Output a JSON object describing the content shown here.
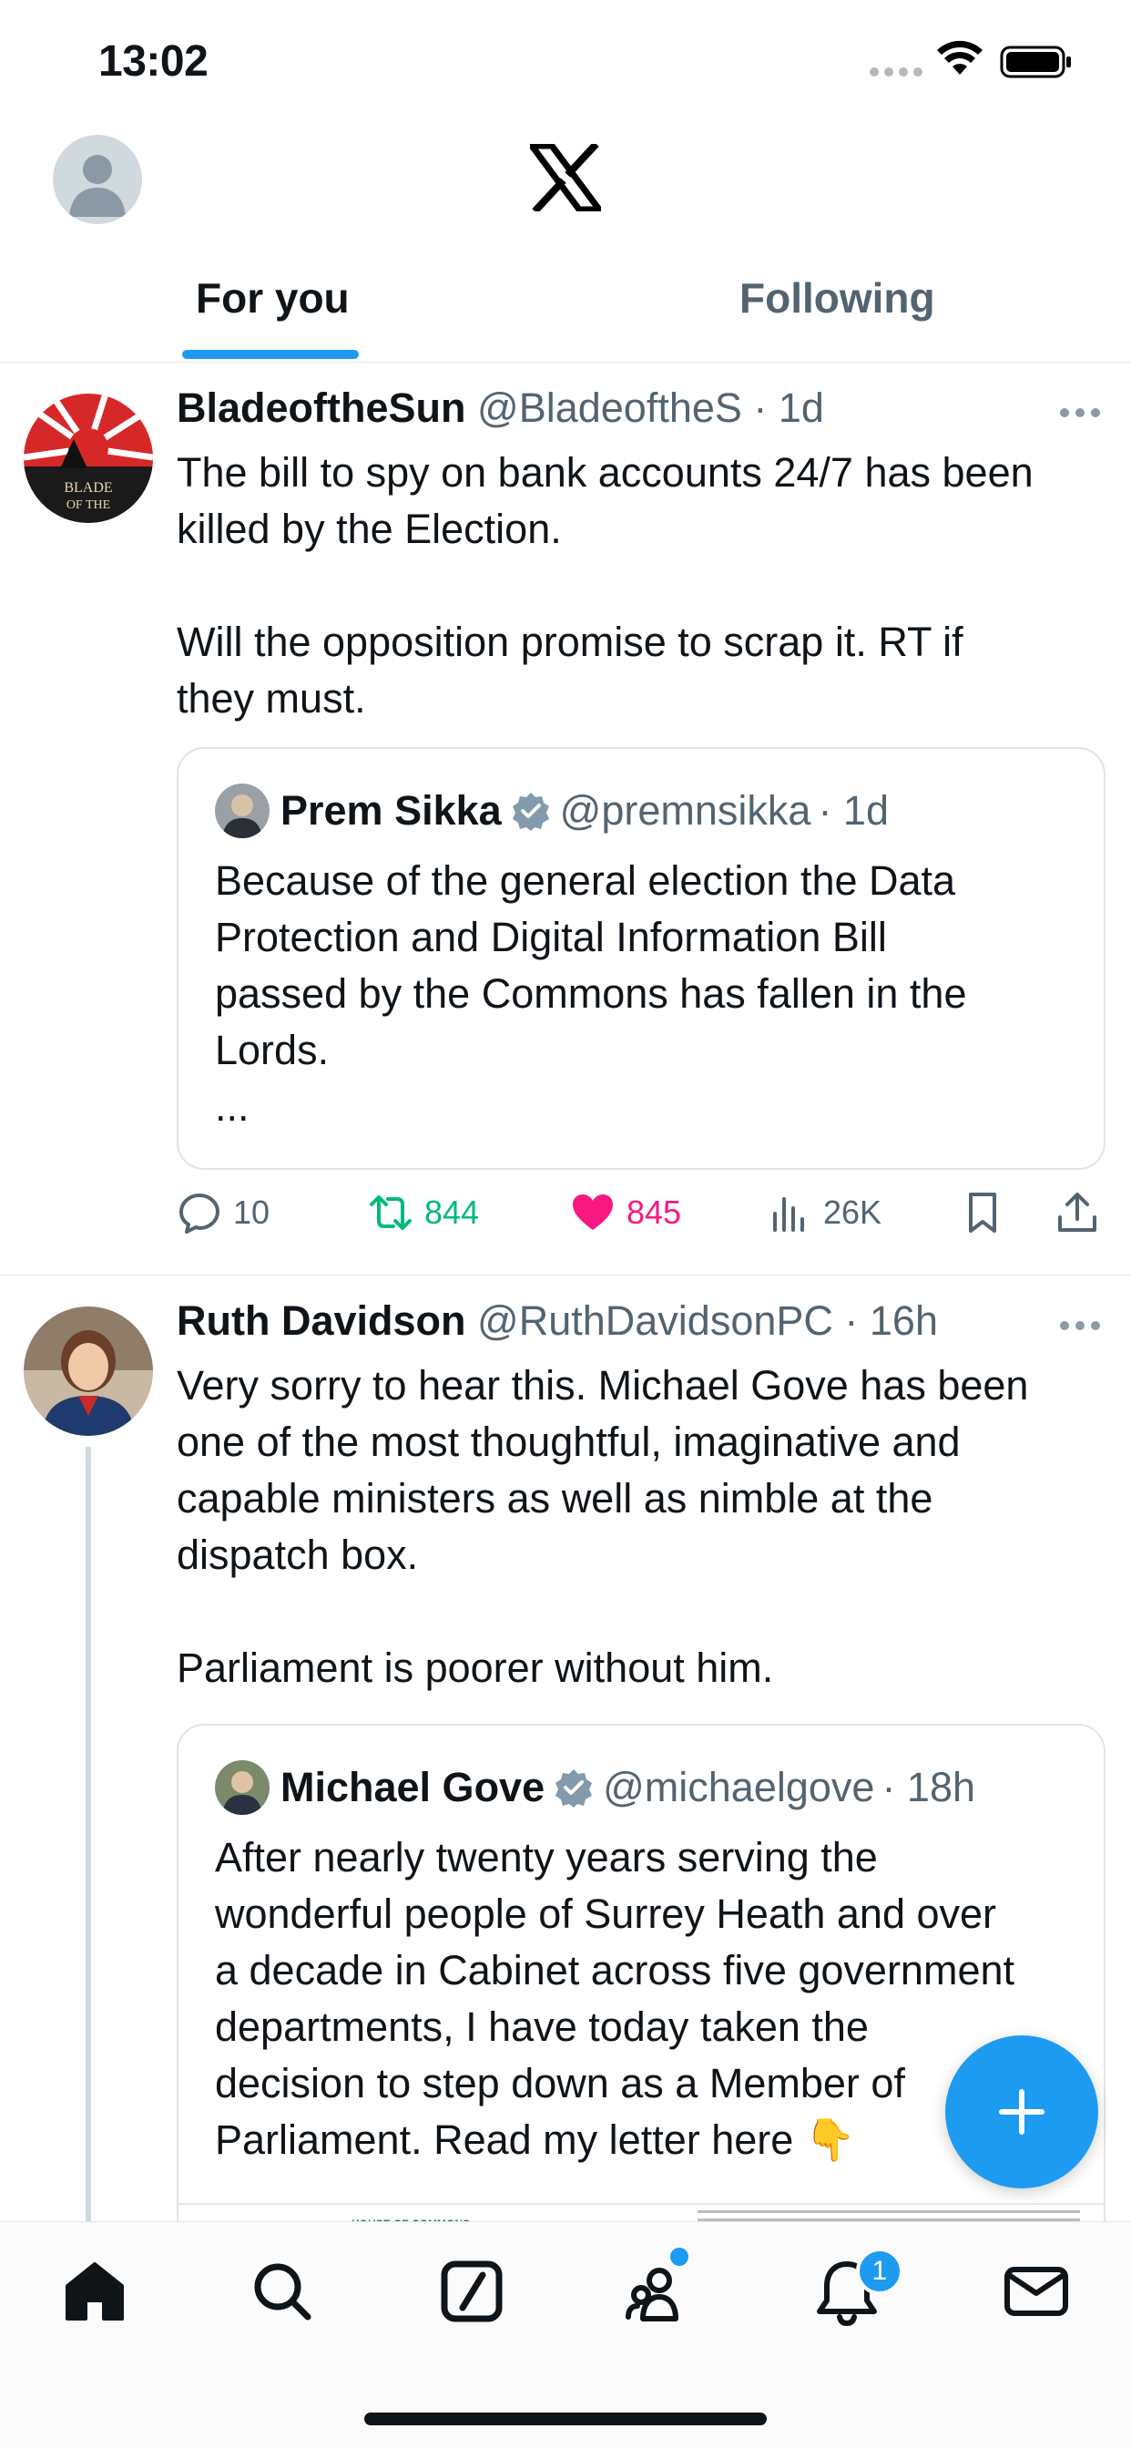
{
  "status_bar": {
    "time": "13:02"
  },
  "tabs": {
    "for_you": "For you",
    "following": "Following"
  },
  "posts": [
    {
      "name": "BladeoftheSun",
      "handle": "@BladeoftheS",
      "time": "· 1d",
      "text_lines": [
        "The bill to spy on bank accounts 24/7 has been",
        "killed by the Election.",
        "",
        "Will the opposition promise to scrap it. RT if",
        "they must."
      ],
      "quote": {
        "name": "Prem Sikka",
        "handle": "@premnsikka",
        "time": "· 1d",
        "text_lines": [
          "Because of the general election the Data",
          "Protection and Digital Information Bill",
          "passed by the Commons has fallen in the",
          "Lords.",
          "..."
        ]
      },
      "stats": {
        "replies": "10",
        "retweets": "844",
        "likes": "845",
        "views": "26K"
      }
    },
    {
      "name": "Ruth Davidson",
      "handle": "@RuthDavidsonPC",
      "time": "· 16h",
      "text_lines": [
        "Very sorry to hear this. Michael Gove has been",
        "one of the most thoughtful, imaginative and",
        "capable ministers as well as nimble at the",
        "dispatch box.",
        "",
        "Parliament is poorer without him."
      ],
      "quote": {
        "name": "Michael Gove",
        "handle": "@michaelgove",
        "time": "· 18h",
        "text_lines": [
          "After nearly twenty years serving the",
          "wonderful people of Surrey Heath and over",
          "a decade in Cabinet across five government",
          "departments, I have today taken the",
          "decision to step down as a Member of",
          "Parliament.  Read my letter here 👇"
        ],
        "attachment_label": "HOUSE OF COMMONS"
      }
    }
  ],
  "bottom_nav": {
    "notifications_badge": "1"
  },
  "colors": {
    "accent": "#1d9bf0",
    "retweet": "#00ba7c",
    "like": "#f91880",
    "muted": "#536471"
  },
  "icons": [
    "x-logo-icon",
    "reply-icon",
    "retweet-icon",
    "heart-icon",
    "views-icon",
    "bookmark-icon",
    "share-icon",
    "verified-icon",
    "plus-icon",
    "home-icon",
    "search-icon",
    "grok-icon",
    "communities-icon",
    "bell-icon",
    "mail-icon"
  ]
}
